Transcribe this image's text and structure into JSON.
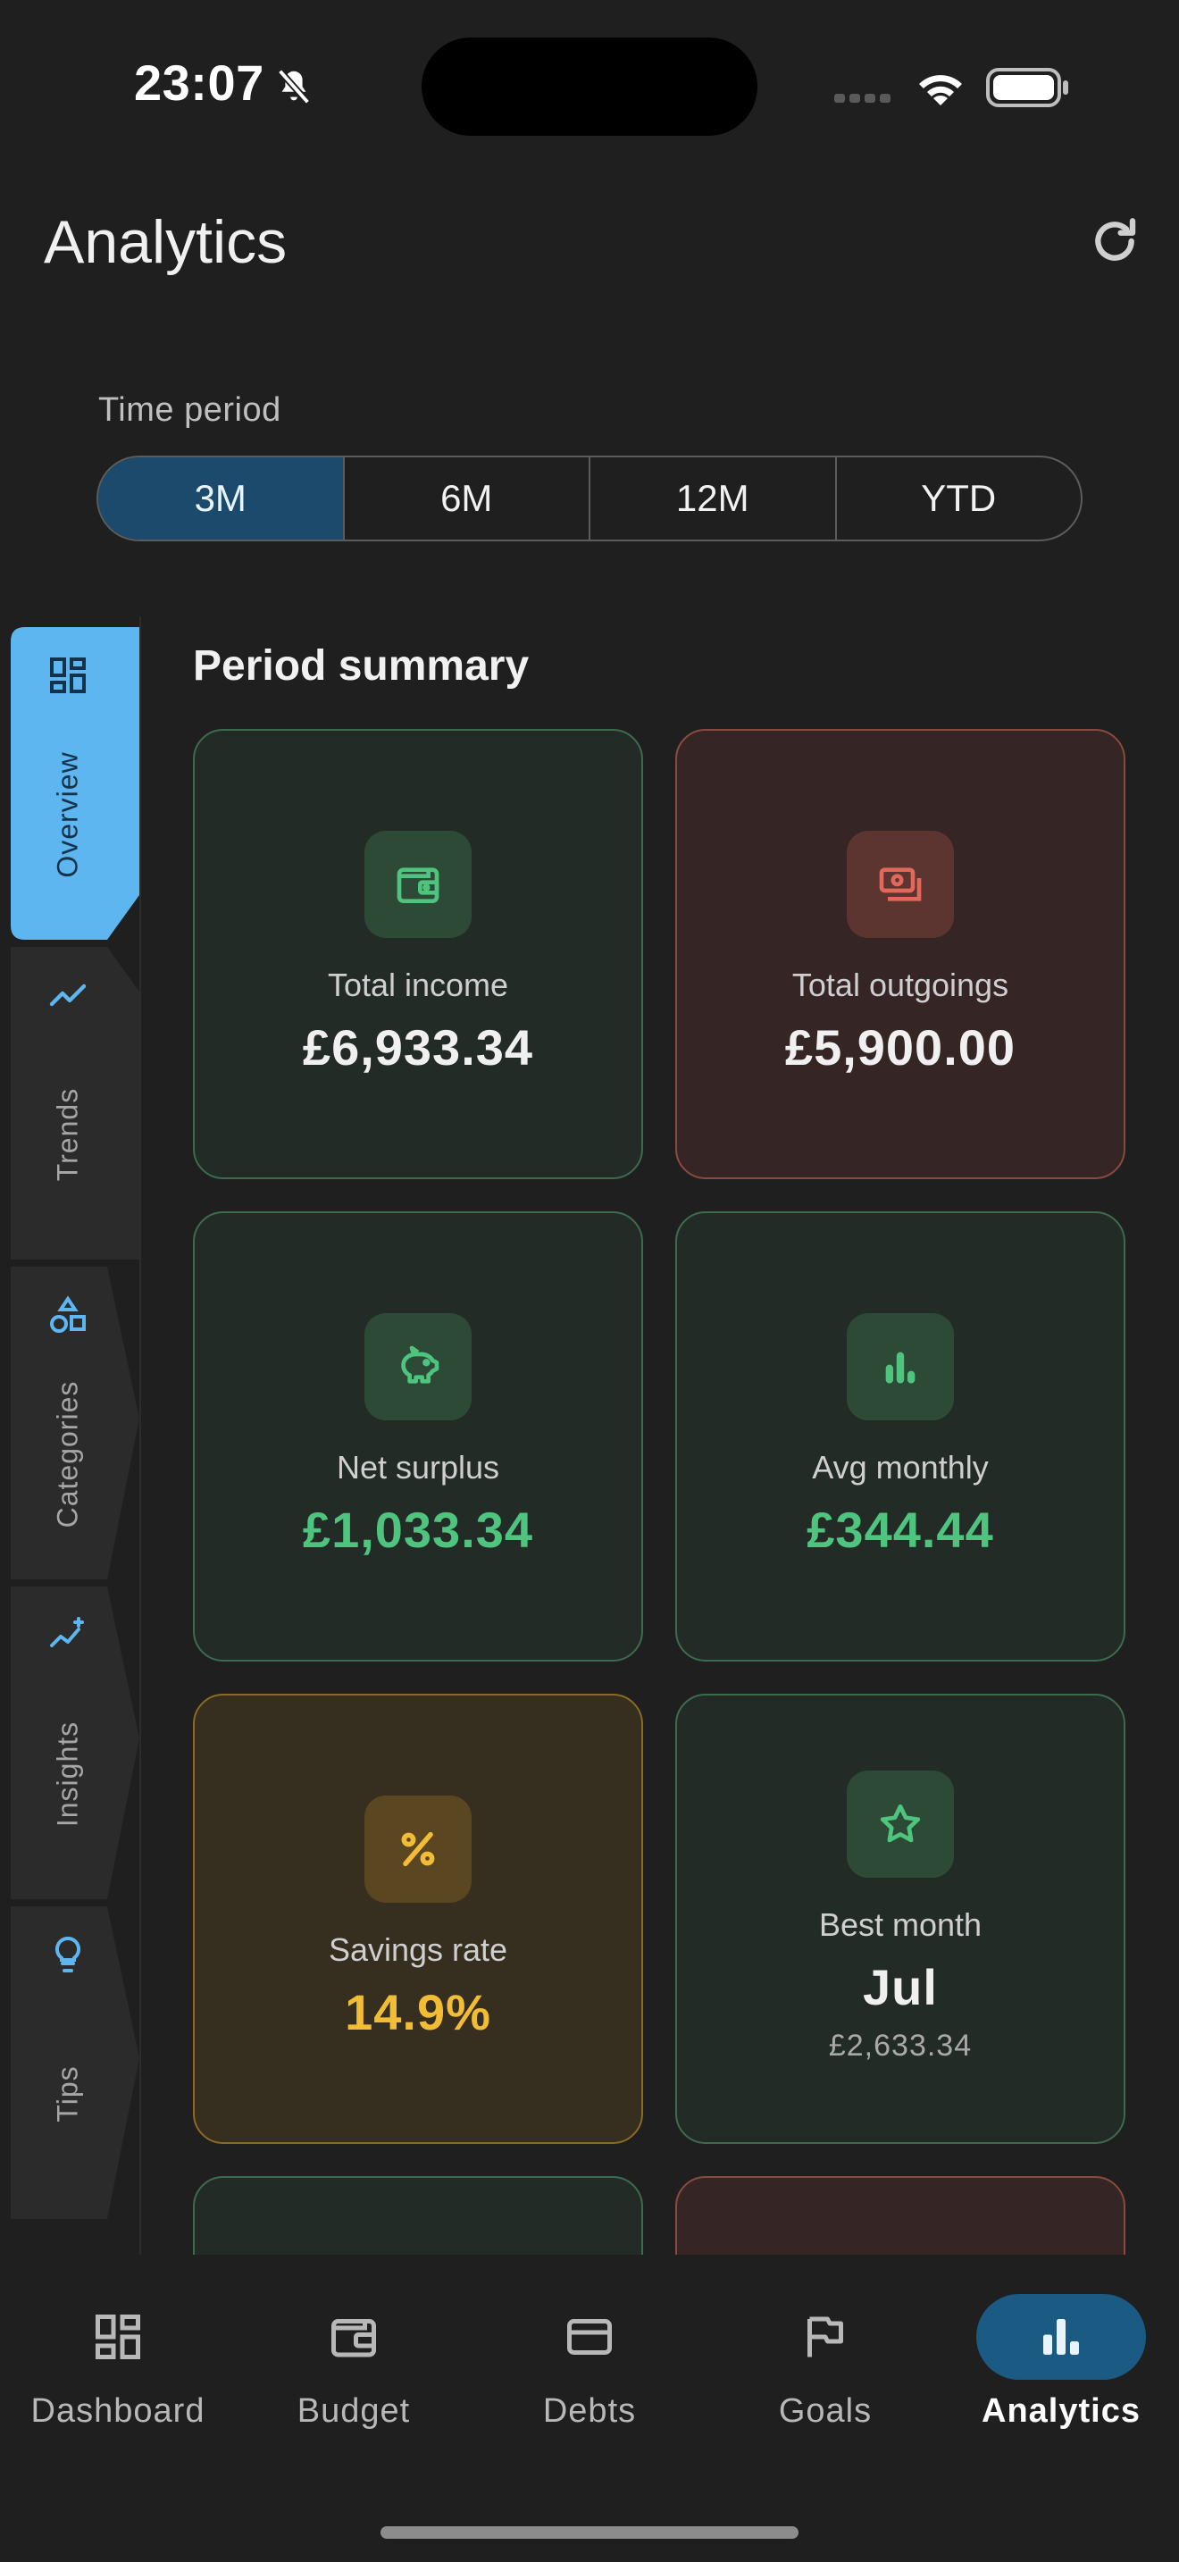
{
  "status_bar": {
    "time": "23:07"
  },
  "header": {
    "title": "Analytics",
    "refresh_icon": "refresh-icon"
  },
  "time_period": {
    "label": "Time period",
    "options": [
      "3M",
      "6M",
      "12M",
      "YTD"
    ],
    "selected": "3M"
  },
  "side_tabs": [
    {
      "label": "Overview",
      "icon": "dashboard-icon",
      "active": true
    },
    {
      "label": "Trends",
      "icon": "trend-line-icon",
      "active": false
    },
    {
      "label": "Categories",
      "icon": "shapes-icon",
      "active": false
    },
    {
      "label": "Insights",
      "icon": "sparkle-chart-icon",
      "active": false
    },
    {
      "label": "Tips",
      "icon": "lightbulb-icon",
      "active": false
    }
  ],
  "summary": {
    "title": "Period summary",
    "cards": [
      {
        "label": "Total income",
        "value": "£6,933.34",
        "icon": "wallet-icon",
        "tone": "green",
        "value_color": "#f0f0f0"
      },
      {
        "label": "Total outgoings",
        "value": "£5,900.00",
        "icon": "money-icon",
        "tone": "red",
        "value_color": "#f0f0f0"
      },
      {
        "label": "Net surplus",
        "value": "£1,033.34",
        "icon": "piggy-bank-icon",
        "tone": "green",
        "value_color": "#4fc47e"
      },
      {
        "label": "Avg monthly",
        "value": "£344.44",
        "icon": "bar-chart-icon",
        "tone": "green",
        "value_color": "#4fc47e"
      },
      {
        "label": "Savings rate",
        "value": "14.9%",
        "icon": "percent-icon",
        "tone": "amber",
        "value_color": "#f2bd34"
      },
      {
        "label": "Best month",
        "value": "Jul",
        "sub": "£2,633.34",
        "icon": "star-icon",
        "tone": "green",
        "value_color": "#f0f0f0"
      }
    ]
  },
  "bottom_nav": [
    {
      "label": "Dashboard",
      "icon": "dashboard-icon",
      "active": false
    },
    {
      "label": "Budget",
      "icon": "wallet-icon",
      "active": false
    },
    {
      "label": "Debts",
      "icon": "credit-card-icon",
      "active": false
    },
    {
      "label": "Goals",
      "icon": "flag-icon",
      "active": false
    },
    {
      "label": "Analytics",
      "icon": "bar-chart-icon",
      "active": true
    }
  ],
  "colors": {
    "accent": "#5db6f0",
    "green": "#4fc47e",
    "red": "#e2685a",
    "amber": "#f2bd34"
  }
}
